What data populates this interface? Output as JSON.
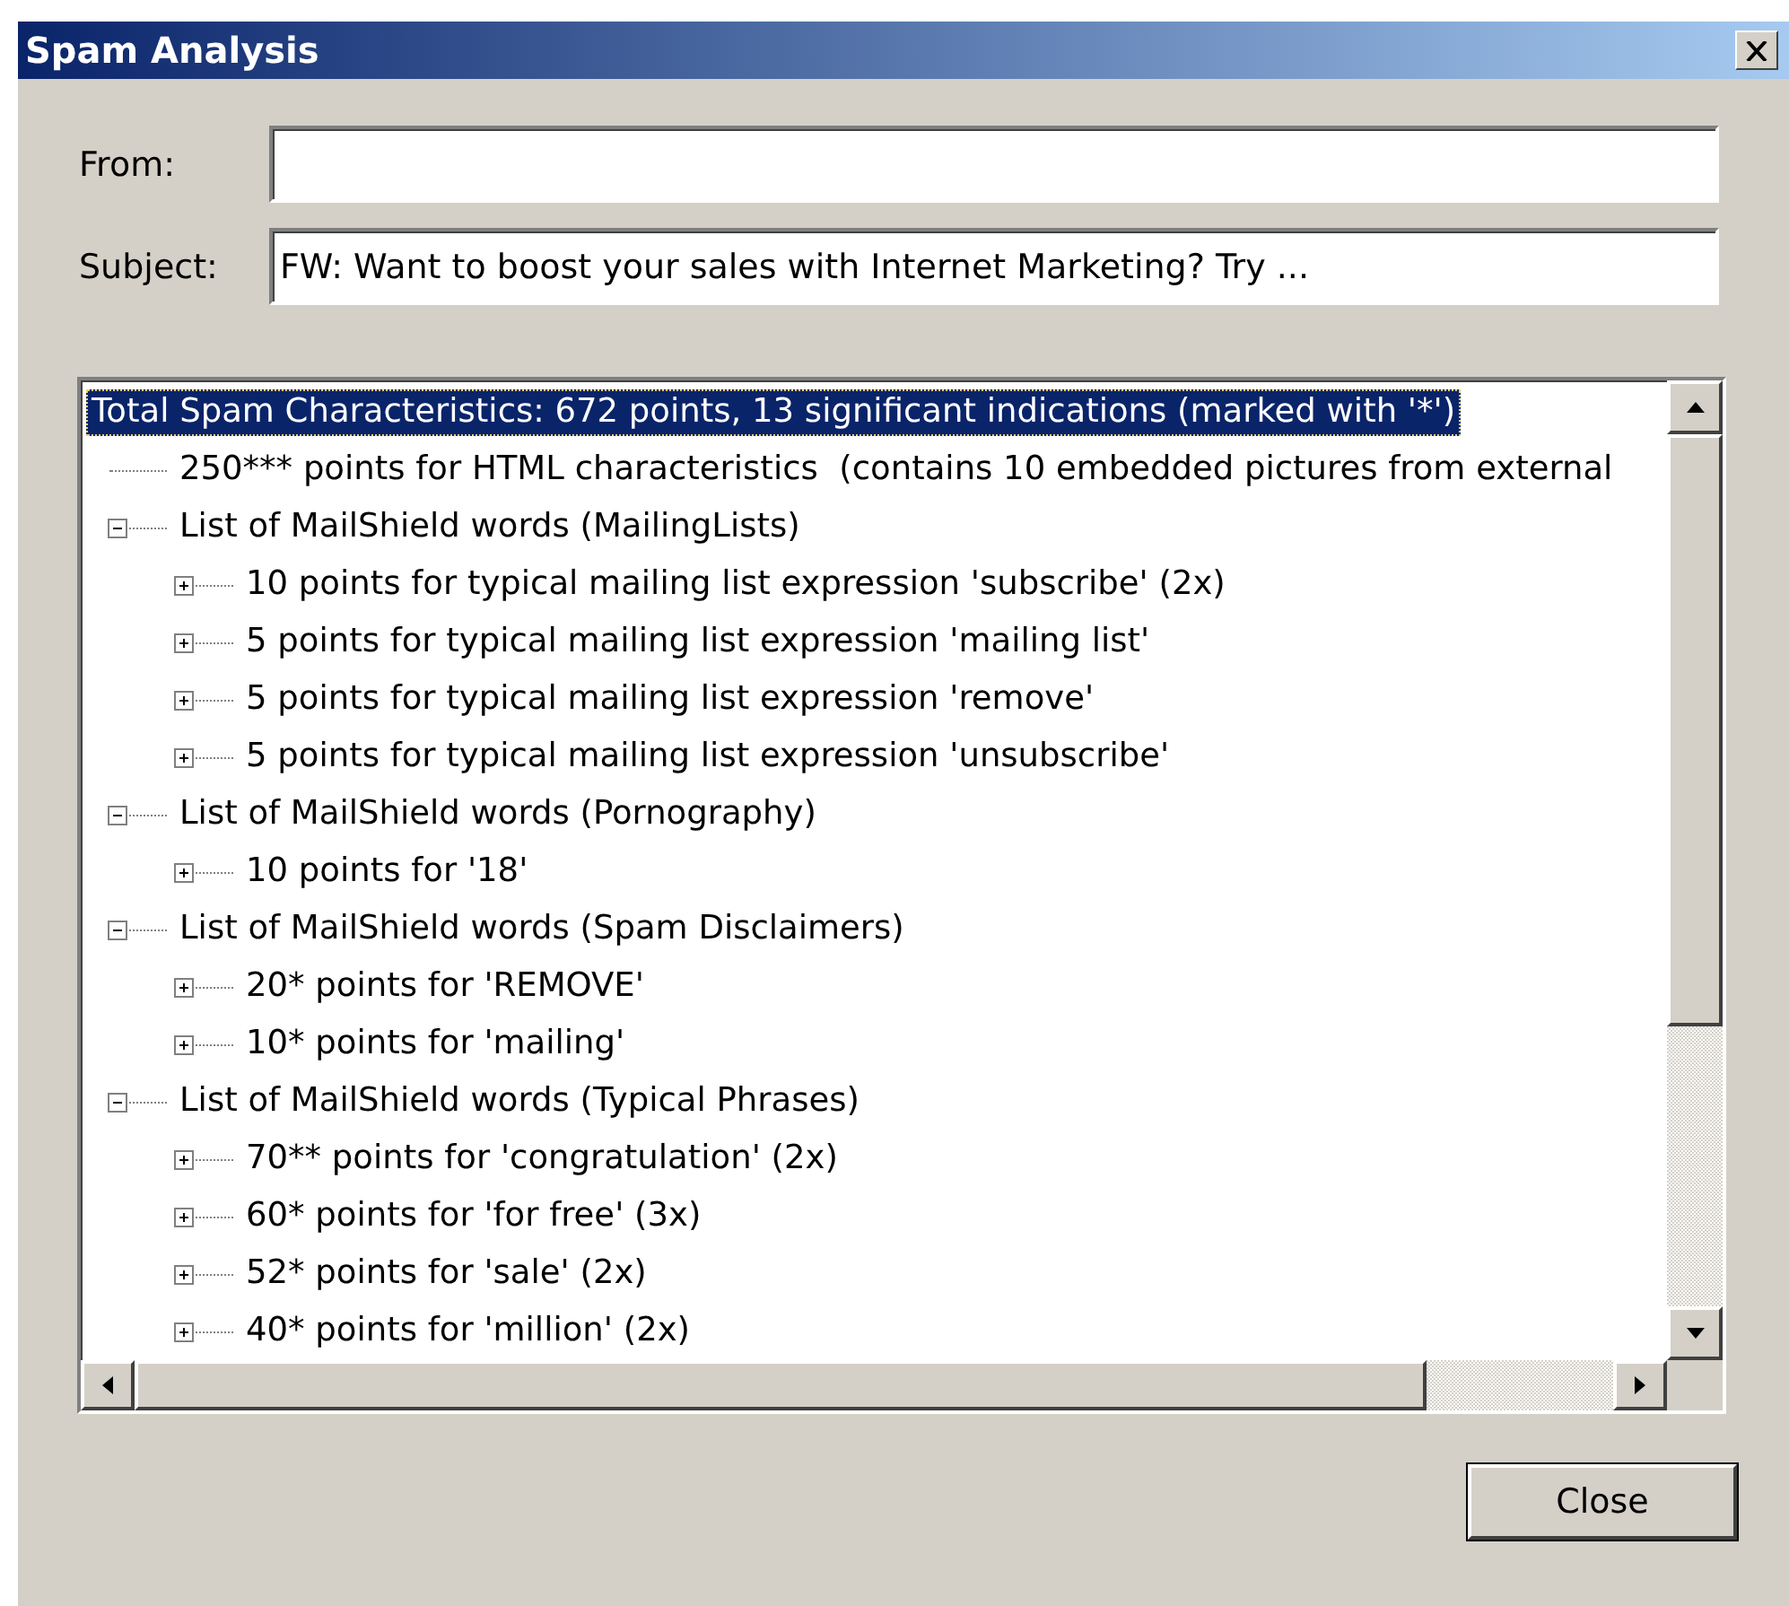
{
  "window": {
    "title": "Spam Analysis"
  },
  "fields": [
    {
      "label": "From:"
    },
    {
      "label": "Subject:",
      "value": "FW: Want to boost your sales with Internet Marketing? Try ..."
    }
  ],
  "tree": [
    {
      "label": "Total Spam Characteristics: 672 points, 13 significant indications (marked with '*')",
      "selected": true,
      "children": [
        {
          "label": "250*** points for HTML characteristics  (contains 10 embedded pictures from external",
          "selected": false
        },
        {
          "label": "List of MailShield words (MailingLists)",
          "selected": false,
          "expanded": true,
          "children": [
            {
              "label": "10 points for typical mailing list expression 'subscribe' (2x)",
              "selected": false,
              "expanded": false
            },
            {
              "label": "5 points for typical mailing list expression 'mailing list'",
              "selected": false,
              "expanded": false
            },
            {
              "label": "5 points for typical mailing list expression 'remove'",
              "selected": false,
              "expanded": false
            },
            {
              "label": "5 points for typical mailing list expression 'unsubscribe'",
              "selected": false,
              "expanded": false
            }
          ]
        },
        {
          "label": "List of MailShield words (Pornography)",
          "selected": false,
          "expanded": true,
          "children": [
            {
              "label": "10 points for '18'",
              "selected": false,
              "expanded": false
            }
          ]
        },
        {
          "label": "List of MailShield words (Spam Disclaimers)",
          "selected": false,
          "expanded": true,
          "children": [
            {
              "label": "20* points for 'REMOVE'",
              "selected": false,
              "expanded": false
            },
            {
              "label": "10* points for 'mailing'",
              "selected": false,
              "expanded": false
            }
          ]
        },
        {
          "label": "List of MailShield words (Typical Phrases)",
          "selected": false,
          "expanded": true,
          "children": [
            {
              "label": "70** points for 'congratulation' (2x)",
              "selected": false,
              "expanded": false
            },
            {
              "label": "60* points for 'for free' (3x)",
              "selected": false,
              "expanded": false
            },
            {
              "label": "52* points for 'sale' (2x)",
              "selected": false,
              "expanded": false
            },
            {
              "label": "40* points for 'million' (2x)",
              "selected": false,
              "expanded": false
            }
          ]
        }
      ]
    }
  ],
  "buttons": [
    {
      "label": "Close"
    }
  ]
}
